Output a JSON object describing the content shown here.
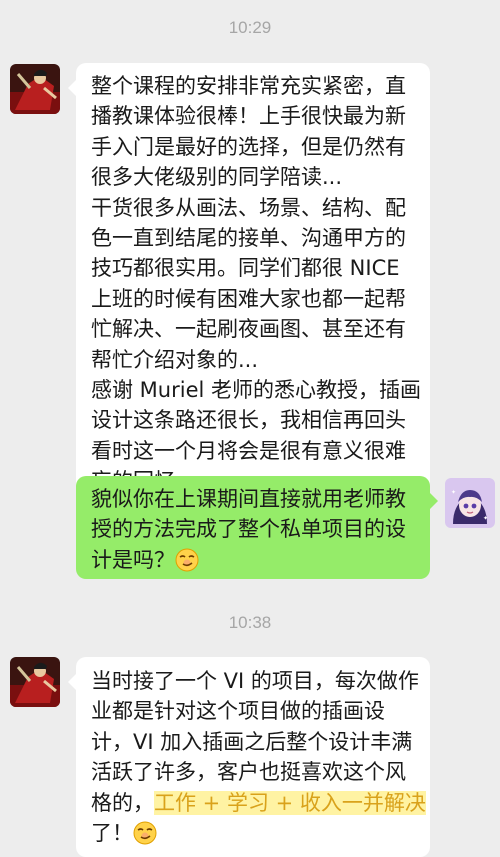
{
  "timestamps": [
    "10:29",
    "10:38"
  ],
  "messages": [
    {
      "sender": "contact",
      "lines": [
        "整个课程的安排非常充实紧密，直",
        "播教课体验很棒！上手很快最为新",
        "手入门是最好的选择，但是仍然有",
        "很多大佬级别的同学陪读...",
        "干货很多从画法、场景、结构、配",
        "色一直到结尾的接单、沟通甲方的",
        "技巧都很实用。同学们都很 NICE",
        "上班的时候有困难大家也都一起帮",
        "忙解决、一起刷夜画图、甚至还有",
        "帮忙介绍对象的...",
        "感谢 Muriel 老师的悉心教授，插画",
        "设计这条路还很长，我相信再回头",
        "看时这一个月将会是很有意义很难",
        "忘的回忆。"
      ]
    },
    {
      "sender": "me",
      "lines": [
        "貌似你在上课期间直接就用老师教",
        "授的方法完成了整个私单项目的设",
        "计是吗？"
      ],
      "emoji": "smirk-emoji"
    },
    {
      "sender": "contact",
      "lines": [
        "当时接了一个 VI 的项目，每次做作",
        "业都是针对这个项目做的插画设",
        "计，VI 加入插画之后整个设计丰满",
        "活跃了许多，客户也挺喜欢这个风"
      ],
      "line5_prefix": "格的，",
      "line5_highlight": "工作 + 学习 + 收入一并解决",
      "line6": "了！",
      "emoji": "smirk-emoji"
    }
  ],
  "colors": {
    "background": "#ededed",
    "incoming_bubble": "#ffffff",
    "outgoing_bubble": "#95ec69",
    "highlight_text": "#d9a21b"
  }
}
